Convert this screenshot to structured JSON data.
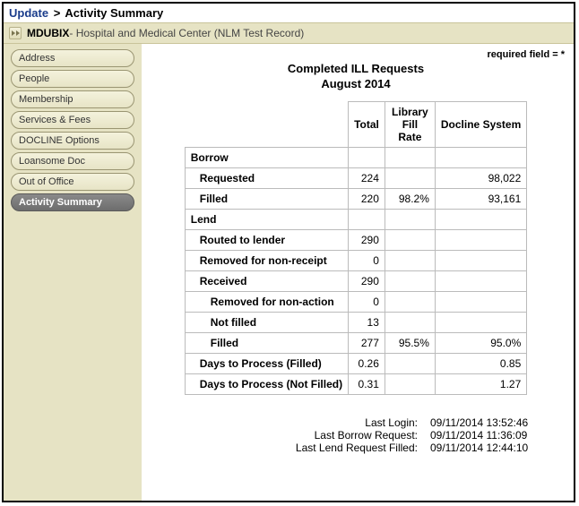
{
  "breadcrumb": {
    "root": "Update",
    "sep": ">",
    "current": "Activity Summary"
  },
  "institution": {
    "code": "MDUBIX",
    "dash": " - ",
    "name": "Hospital and Medical Center (NLM Test Record)"
  },
  "required_text": "required field = *",
  "sidebar": {
    "items": [
      {
        "label": "Address"
      },
      {
        "label": "People"
      },
      {
        "label": "Membership"
      },
      {
        "label": "Services & Fees"
      },
      {
        "label": "DOCLINE Options"
      },
      {
        "label": "Loansome Doc"
      },
      {
        "label": "Out of Office"
      },
      {
        "label": "Activity Summary"
      }
    ],
    "active_index": 7
  },
  "report": {
    "title_line1": "Completed ILL Requests",
    "title_line2": "August 2014",
    "headers": {
      "col1": "Total",
      "col2": "Library Fill Rate",
      "col3": "Docline System"
    },
    "rows": [
      {
        "label": "Borrow",
        "indent": 0,
        "total": "",
        "rate": "",
        "sys": ""
      },
      {
        "label": "Requested",
        "indent": 1,
        "total": "224",
        "rate": "",
        "sys": "98,022"
      },
      {
        "label": "Filled",
        "indent": 1,
        "total": "220",
        "rate": "98.2%",
        "sys": "93,161"
      },
      {
        "label": "Lend",
        "indent": 0,
        "total": "",
        "rate": "",
        "sys": ""
      },
      {
        "label": "Routed to lender",
        "indent": 1,
        "total": "290",
        "rate": "",
        "sys": ""
      },
      {
        "label": "Removed for non-receipt",
        "indent": 1,
        "total": "0",
        "rate": "",
        "sys": ""
      },
      {
        "label": "Received",
        "indent": 1,
        "total": "290",
        "rate": "",
        "sys": ""
      },
      {
        "label": "Removed for non-action",
        "indent": 2,
        "total": "0",
        "rate": "",
        "sys": ""
      },
      {
        "label": "Not filled",
        "indent": 2,
        "total": "13",
        "rate": "",
        "sys": ""
      },
      {
        "label": "Filled",
        "indent": 2,
        "total": "277",
        "rate": "95.5%",
        "sys": "95.0%"
      },
      {
        "label": "Days to Process (Filled)",
        "indent": 1,
        "total": "0.26",
        "rate": "",
        "sys": "0.85"
      },
      {
        "label": "Days to Process (Not Filled)",
        "indent": 1,
        "total": "0.31",
        "rate": "",
        "sys": "1.27"
      }
    ]
  },
  "footer": {
    "rows": [
      {
        "k": "Last Login:",
        "v": "09/11/2014 13:52:46"
      },
      {
        "k": "Last Borrow Request:",
        "v": "09/11/2014 11:36:09"
      },
      {
        "k": "Last Lend Request Filled:",
        "v": "09/11/2014 12:44:10"
      }
    ]
  }
}
